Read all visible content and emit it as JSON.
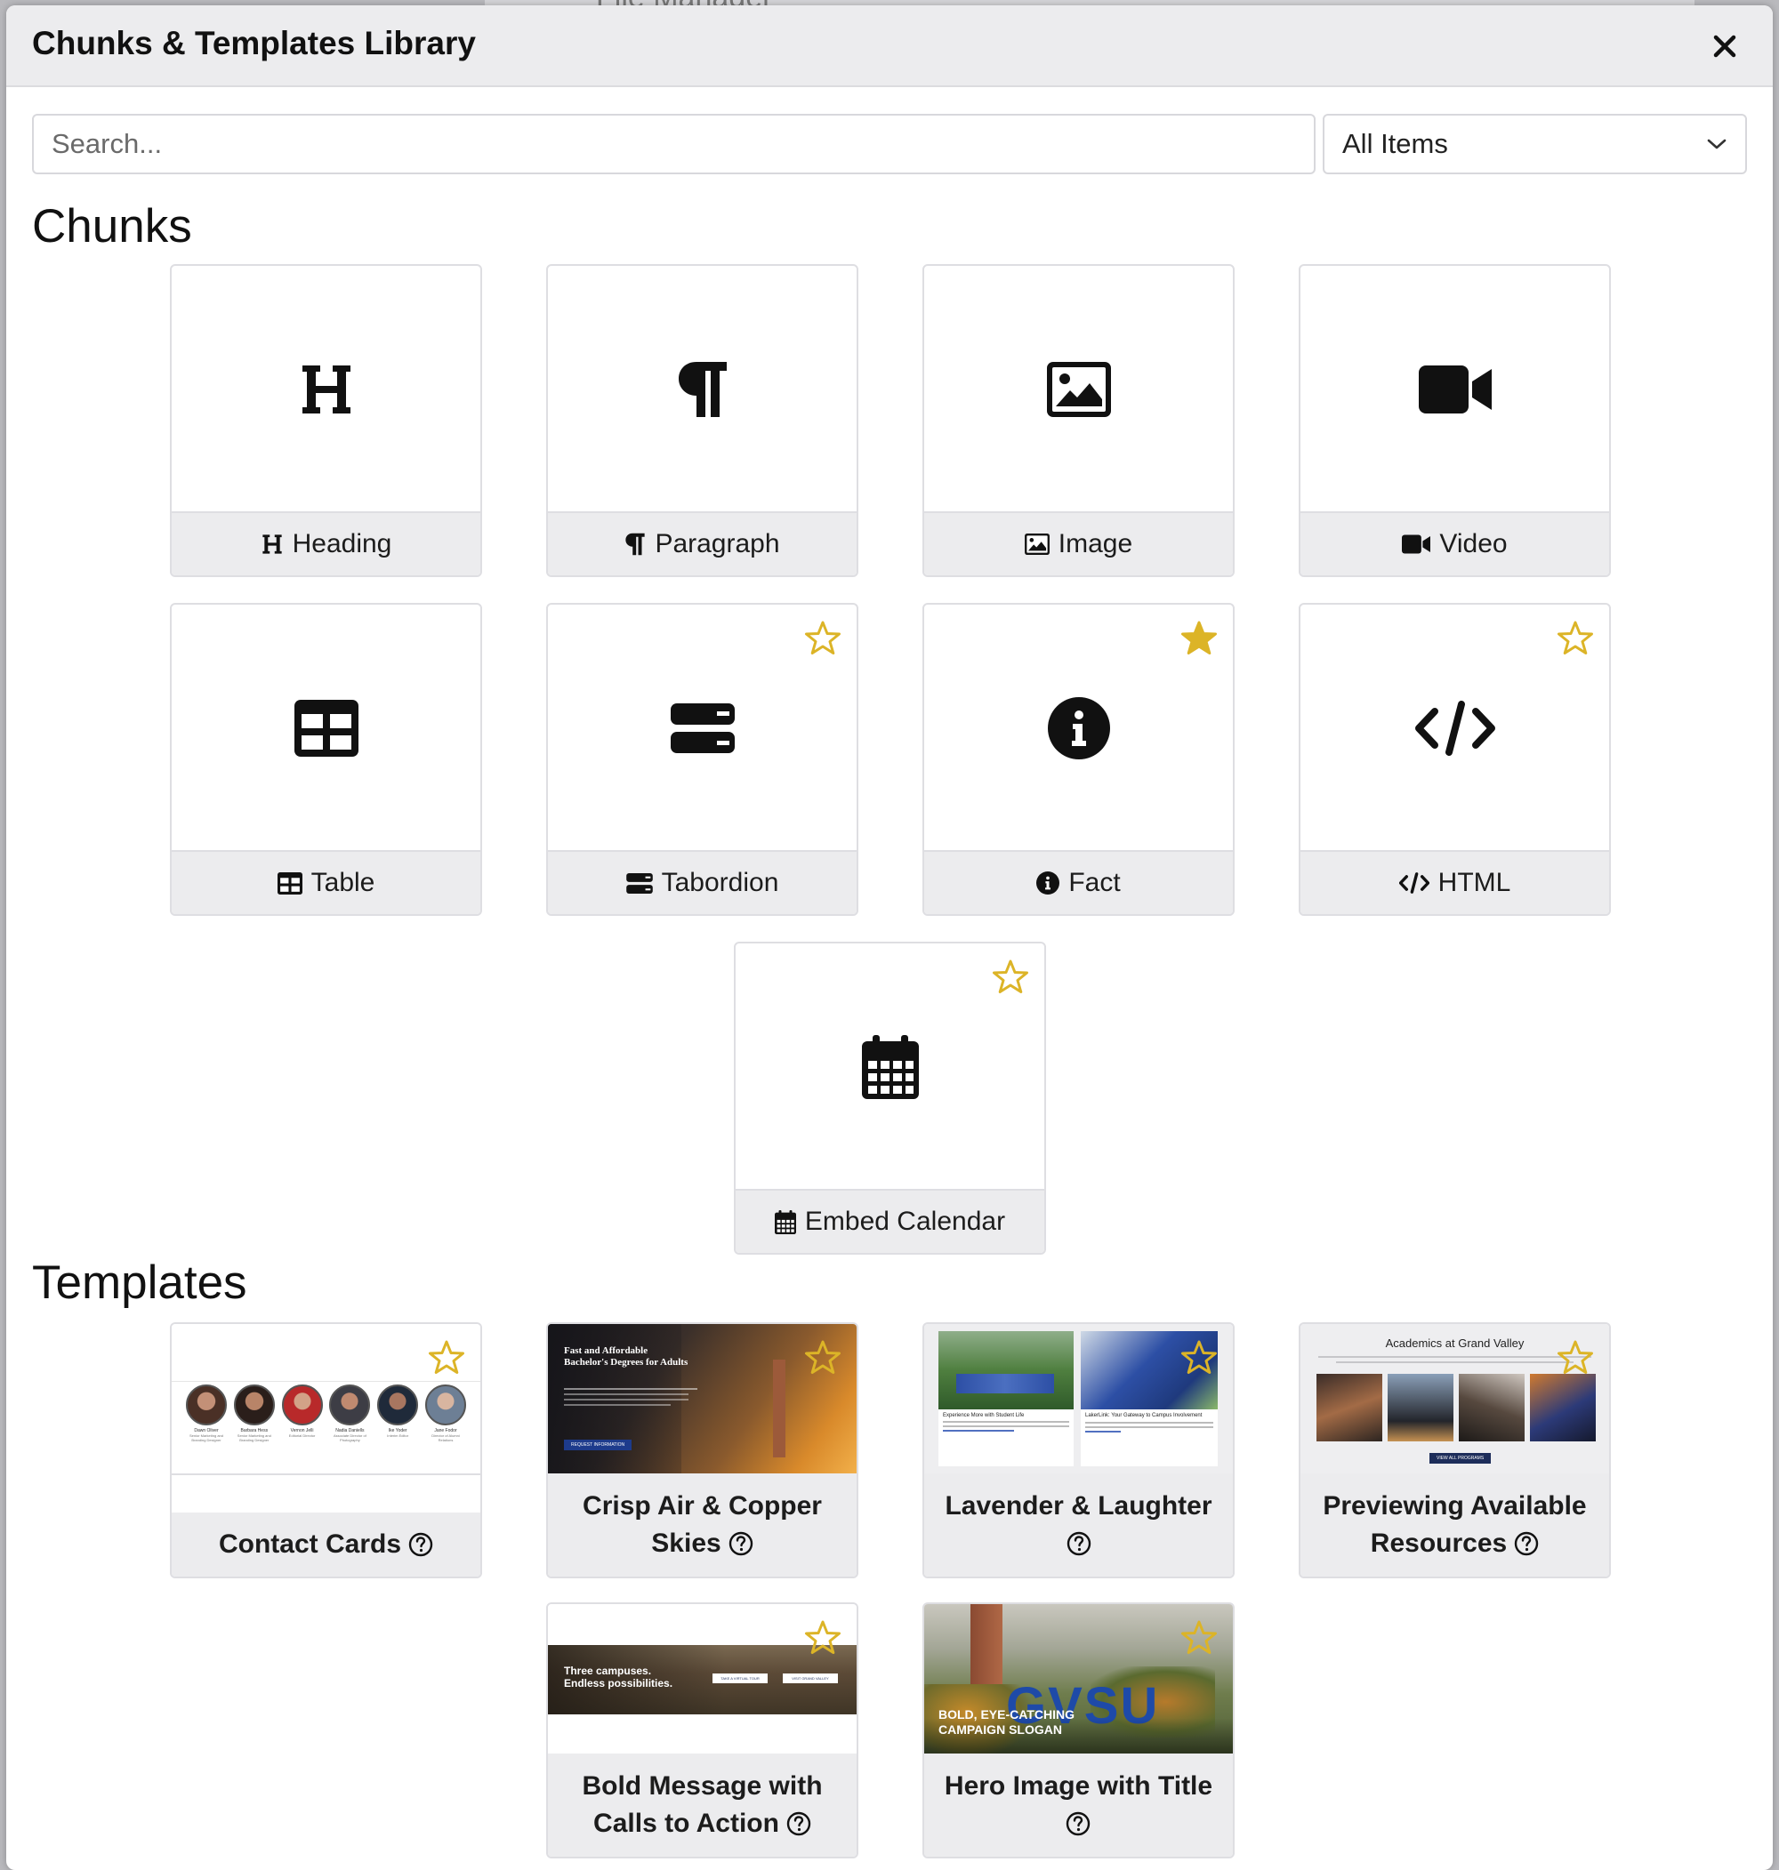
{
  "backdrop": {
    "title": "File Manager"
  },
  "modal": {
    "title": "Chunks & Templates Library",
    "close_label": "×"
  },
  "search": {
    "placeholder": "Search...",
    "value": ""
  },
  "filter": {
    "selected": "All Items"
  },
  "sections": {
    "chunks": "Chunks",
    "templates": "Templates"
  },
  "chunks": [
    {
      "label": "Heading",
      "icon": "heading-icon",
      "favorite": null
    },
    {
      "label": "Paragraph",
      "icon": "paragraph-icon",
      "favorite": null
    },
    {
      "label": "Image",
      "icon": "image-icon",
      "favorite": null
    },
    {
      "label": "Video",
      "icon": "video-icon",
      "favorite": null
    },
    {
      "label": "Table",
      "icon": "table-icon",
      "favorite": null
    },
    {
      "label": "Tabordion",
      "icon": "tabordion-icon",
      "favorite": false
    },
    {
      "label": "Fact",
      "icon": "info-circle-icon",
      "favorite": true
    },
    {
      "label": "HTML",
      "icon": "code-icon",
      "favorite": false
    },
    {
      "label": "Embed Calendar",
      "icon": "calendar-icon",
      "favorite": false
    }
  ],
  "templates": [
    {
      "label": "Contact Cards",
      "favorite": false,
      "thumb_people": [
        {
          "name": "Dawn Oliver",
          "role": "Senior Marketing and Branding Designer"
        },
        {
          "name": "Barbara Hess",
          "role": "Senior Marketing and Branding Designer"
        },
        {
          "name": "Vernon Jelli",
          "role": "Editorial Director"
        },
        {
          "name": "Nadia Daniells",
          "role": "Associate Director of Photography"
        },
        {
          "name": "Ike Yoder",
          "role": "Interim Editor"
        },
        {
          "name": "Jane Fodor",
          "role": "Director of Alumni Relations"
        }
      ]
    },
    {
      "label": "Crisp Air & Copper Skies",
      "favorite": false,
      "thumb_heading": "Fast and Affordable Bachelor's Degrees for Adults",
      "thumb_button": "REQUEST INFORMATION"
    },
    {
      "label": "Lavender & Laughter",
      "favorite": false,
      "thumb_left_title": "Experience More with Student Life",
      "thumb_right_title": "LakerLink: Your Gateway to Campus Involvement"
    },
    {
      "label": "Previewing Available Resources",
      "favorite": false,
      "thumb_title": "Academics at Grand Valley",
      "thumb_button": "VIEW ALL PROGRAMS"
    },
    {
      "label": "Bold Message with Calls to Action",
      "favorite": false,
      "thumb_text": "Three campuses. Endless possibilities.",
      "thumb_buttons": [
        "TAKE A VIRTUAL TOUR",
        "VISIT GRAND VALLEY"
      ]
    },
    {
      "label": "Hero Image with Title",
      "favorite": false,
      "thumb_text": "BOLD, EYE-CATCHING CAMPAIGN SLOGAN",
      "thumb_sign": "GVSU"
    }
  ],
  "colors": {
    "star": "#dcb427",
    "header_bg": "#ececee",
    "label_bg": "#ececee"
  }
}
